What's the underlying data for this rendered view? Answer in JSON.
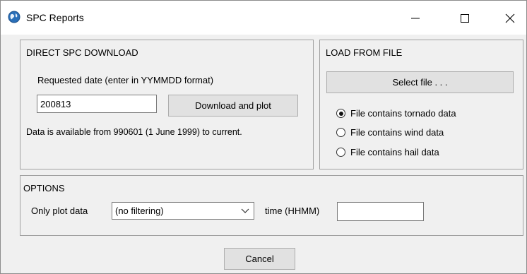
{
  "window": {
    "title": "SPC Reports"
  },
  "direct": {
    "title": "DIRECT SPC DOWNLOAD",
    "date_label": "Requested date (enter in YYMMDD format)",
    "date_value": "200813",
    "download_button": "Download and plot",
    "availability": "Data is available from 990601 (1 June 1999) to current."
  },
  "load": {
    "title": "LOAD FROM FILE",
    "select_button": "Select file . . .",
    "options": [
      {
        "label": "File contains tornado data",
        "selected": true
      },
      {
        "label": "File contains wind data",
        "selected": false
      },
      {
        "label": "File contains hail data",
        "selected": false
      }
    ]
  },
  "options": {
    "title": "OPTIONS",
    "only_plot_label": "Only plot data",
    "filter_value": "(no filtering)",
    "time_label": "time (HHMM)",
    "time_value": ""
  },
  "footer": {
    "cancel_button": "Cancel"
  },
  "icons": {
    "app": "globe-icon",
    "minimize": "minimize-icon",
    "maximize": "maximize-icon",
    "close": "close-icon",
    "dropdown": "chevron-down-icon"
  }
}
